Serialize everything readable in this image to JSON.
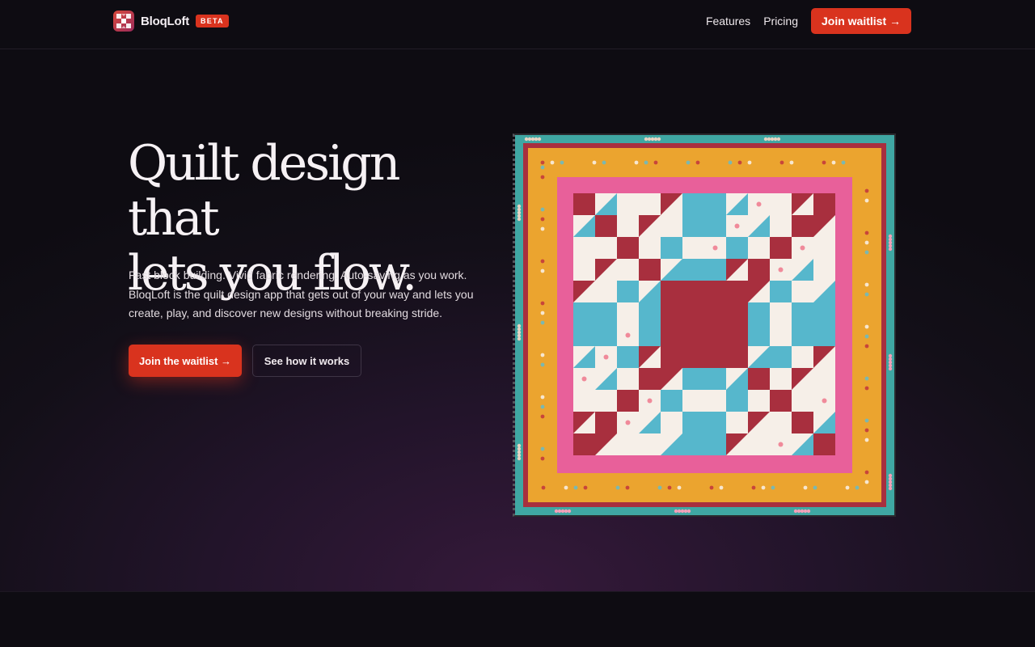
{
  "nav": {
    "brand_name": "BloqLoft",
    "beta_badge": "BETA",
    "links": [
      "Features",
      "Pricing"
    ],
    "cta_label": "Join waitlist →"
  },
  "hero": {
    "headline_line1": "Quilt design that",
    "headline_line2": "lets you flow.",
    "sub_line1": "Fast block building. Vivid fabric rendering. Auto-saving as you work.",
    "sub_line2": "BloqLoft is the quilt design app that gets out of your way and lets you",
    "sub_line3": "create, play, and discover new designs without breaking stride.",
    "primary_cta": "Join the waitlist →",
    "secondary_cta": "See how it works"
  },
  "colors": {
    "accent": "#d9331e",
    "background": "#0e0c12",
    "quilt_teal": "#3fa7a3",
    "quilt_red": "#a82f3e",
    "quilt_gold": "#eba42f",
    "quilt_pink": "#e8609a",
    "quilt_blue": "#56b7cc",
    "quilt_cream": "#f6efe8"
  },
  "icons": {
    "logo": "quilt-block-logo-icon"
  }
}
